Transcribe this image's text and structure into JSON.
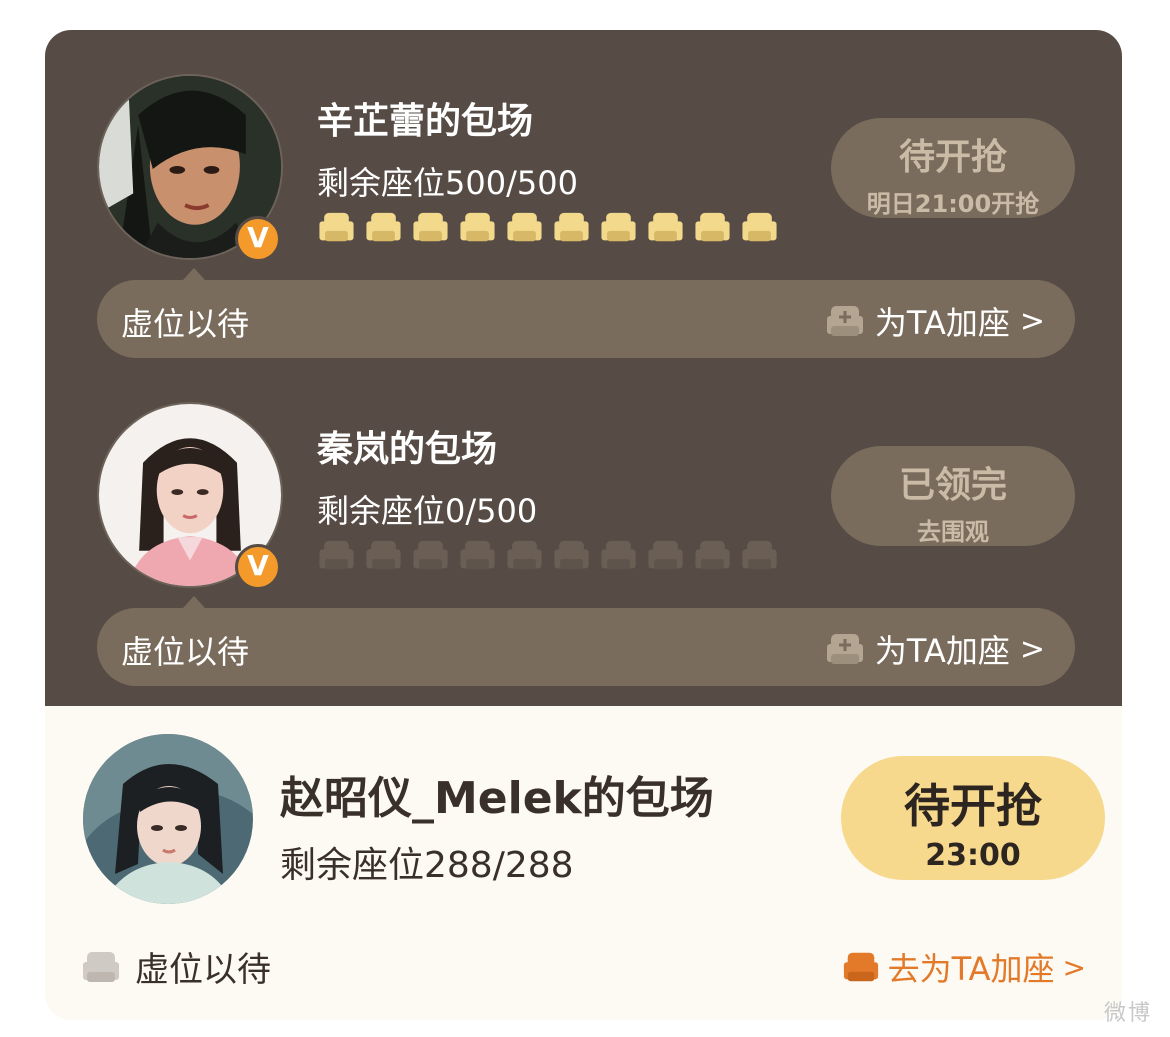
{
  "colors": {
    "dark_panel": "#564c45",
    "pill": "#7a6c5c",
    "seat_gold": "#f2d98b",
    "seat_dim": "#6b5f55",
    "badge_orange": "#f39a2b",
    "light_status": "#f7d98e",
    "add_seat_orange": "#e27a2a"
  },
  "entries": [
    {
      "name": "辛芷蕾的包场",
      "seats_text": "剩余座位500/500",
      "seat_fill": "10 of 10",
      "status_main": "待开抢",
      "status_sub": "明日21:00开抢",
      "badge": "V",
      "bar_left": "虚位以待",
      "bar_right": "为TA加座",
      "chevron": ">",
      "avatar_icon": "person-avatar-icon"
    },
    {
      "name": "秦岚的包场",
      "seats_text": "剩余座位0/500",
      "seat_fill": "0 of 10",
      "status_main": "已领完",
      "status_sub": "去围观",
      "badge": "V",
      "bar_left": "虚位以待",
      "bar_right": "为TA加座",
      "chevron": ">",
      "avatar_icon": "person-avatar-icon"
    }
  ],
  "highlight": {
    "name": "赵昭仪_Melek的包场",
    "seats_text": "剩余座位288/288",
    "status_main": "待开抢",
    "status_sub": "23:00",
    "left_label": "虚位以待",
    "right_label": "去为TA加座",
    "chevron": ">",
    "avatar_icon": "person-avatar-icon"
  },
  "watermark": "微博"
}
